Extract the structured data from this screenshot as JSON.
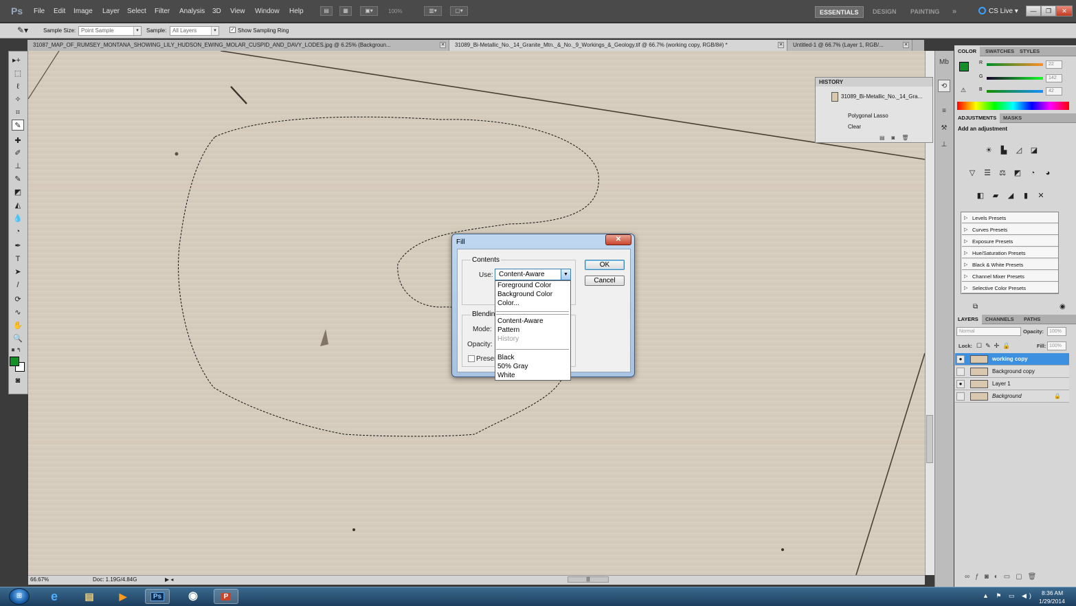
{
  "app": {
    "logo": "Ps"
  },
  "menubar": {
    "items": [
      "File",
      "Edit",
      "Image",
      "Layer",
      "Select",
      "Filter",
      "Analysis",
      "3D",
      "View",
      "Window",
      "Help"
    ],
    "zoom": "100%",
    "workspaces": [
      "ESSENTIALS",
      "DESIGN",
      "PAINTING"
    ],
    "more": "»",
    "cslive": "CS Live"
  },
  "options": {
    "sample_size_label": "Sample Size:",
    "sample_size_value": "Point Sample",
    "sample_label": "Sample:",
    "sample_value": "All Layers",
    "show_ring_label": "Show Sampling Ring"
  },
  "tabs": [
    {
      "label": "31087_MAP_OF_RUMSEY_MONTANA_SHOWING_LILY_HUDSON_EWING_MOLAR_CUSPID_AND_DAVY_LODES.jpg @ 6.25% (Backgroun..."
    },
    {
      "label": "31089_Bi-Metallic_No._14_Granite_Mtn._&_No._9_Workings_&_Geology.tif @ 66.7% (working copy, RGB/8#) *"
    },
    {
      "label": "Untitled-1 @ 66.7% (Layer 1, RGB/..."
    }
  ],
  "status": {
    "zoom": "66.67%",
    "doc": "Doc: 1.19G/4.84G"
  },
  "history": {
    "title": "HISTORY",
    "snapshot": "31089_Bi-Metallic_No._14_Gra...",
    "steps": [
      "Polygonal Lasso",
      "Clear"
    ]
  },
  "color_panel": {
    "tabs": [
      "COLOR",
      "SWATCHES",
      "STYLES"
    ],
    "r_label": "R",
    "g_label": "G",
    "b_label": "B",
    "r": "22",
    "g": "142",
    "b": "42",
    "fg_color": "#168e2a"
  },
  "adjustments": {
    "tabs": [
      "ADJUSTMENTS",
      "MASKS"
    ],
    "heading": "Add an adjustment",
    "presets": [
      "Levels Presets",
      "Curves Presets",
      "Exposure Presets",
      "Hue/Saturation Presets",
      "Black & White Presets",
      "Channel Mixer Presets",
      "Selective Color Presets"
    ]
  },
  "layers": {
    "tabs": [
      "LAYERS",
      "CHANNELS",
      "PATHS"
    ],
    "blend_mode": "Normal",
    "opacity_label": "Opacity:",
    "opacity": "100%",
    "lock_label": "Lock:",
    "fill_label": "Fill:",
    "fill": "100%",
    "items": [
      {
        "name": "working copy"
      },
      {
        "name": "Background copy"
      },
      {
        "name": "Layer 1"
      },
      {
        "name": "Background"
      }
    ]
  },
  "fill_dialog": {
    "title": "Fill",
    "contents_label": "Contents",
    "use_label": "Use:",
    "use_value": "Content-Aware",
    "blending_label": "Blendin",
    "mode_label": "Mode:",
    "opacity_label": "Opacity:",
    "preserve_label": "Preser",
    "ok_label": "OK",
    "cancel_label": "Cancel",
    "dropdown_options": [
      "Foreground Color",
      "Background Color",
      "Color...",
      "Content-Aware",
      "Pattern",
      "History",
      "Black",
      "50% Gray",
      "White"
    ]
  },
  "taskbar": {
    "time": "8:36 AM",
    "date": "1/29/2014"
  }
}
